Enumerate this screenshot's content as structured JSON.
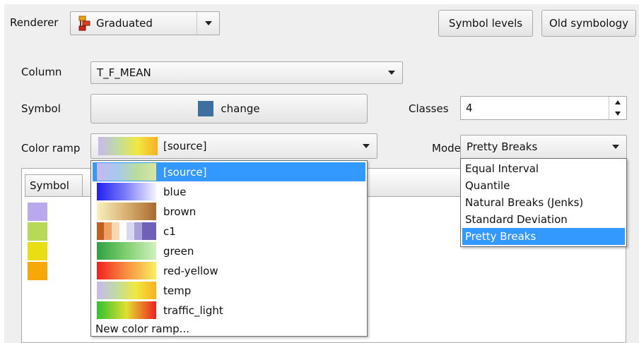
{
  "renderer": {
    "label": "Renderer",
    "value": "Graduated"
  },
  "toolbar": {
    "symbol_levels": "Symbol levels",
    "old_symbology": "Old symbology"
  },
  "column": {
    "label": "Column",
    "value": "T_F_MEAN"
  },
  "symbol": {
    "label": "Symbol",
    "button": "change",
    "color": "#3f6f9f"
  },
  "classes": {
    "label": "Classes",
    "value": "4"
  },
  "color_ramp": {
    "label": "Color ramp",
    "value": "[source]",
    "options": [
      {
        "name": "[source]",
        "selected": true
      },
      {
        "name": "blue"
      },
      {
        "name": "brown"
      },
      {
        "name": "c1"
      },
      {
        "name": "green"
      },
      {
        "name": "red-yellow"
      },
      {
        "name": "temp"
      },
      {
        "name": "traffic_light"
      }
    ],
    "new_ramp": "New color ramp..."
  },
  "mode": {
    "label": "Mode",
    "value": "Pretty Breaks",
    "options": [
      "Equal Interval",
      "Quantile",
      "Natural Breaks (Jenks)",
      "Standard Deviation",
      "Pretty Breaks"
    ],
    "selected": "Pretty Breaks"
  },
  "table": {
    "header_symbol": "Symbol",
    "row_colors": [
      "#b9a8ee",
      "#b7d957",
      "#e9dd13",
      "#f7a707"
    ]
  }
}
